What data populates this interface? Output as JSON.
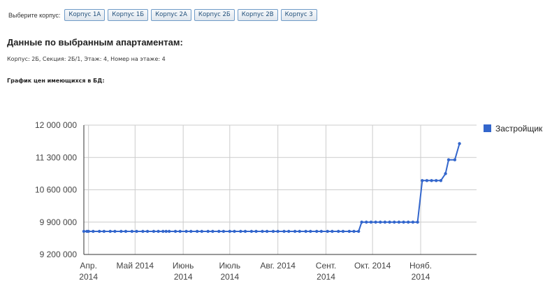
{
  "selector": {
    "prompt": "Выберите корпус:",
    "buttons": [
      "Корпус 1А",
      "Корпус 1Б",
      "Корпус 2А",
      "Корпус 2Б",
      "Корпус 2В",
      "Корпус 3"
    ]
  },
  "heading": "Данные по выбранным апартаментам:",
  "info": "Корпус: 2Б, Секция: 2Б/1, Этаж: 4, Номер на этаже: 4",
  "chart_caption": "График цен имеющихся в БД:",
  "colors": {
    "series": "#3366cc",
    "gridline": "#cccccc",
    "axis": "#333333"
  },
  "chart_data": {
    "type": "line",
    "title": "",
    "xlabel": "",
    "ylabel": "",
    "x_range": [
      "2014-03-29",
      "2014-12-07"
    ],
    "ylim": [
      9200000,
      12000000
    ],
    "y_ticks": [
      9200000,
      9900000,
      10600000,
      11300000,
      12000000
    ],
    "y_tick_labels": [
      "9 200 000",
      "9 900 000",
      "10 600 000",
      "11 300 000",
      "12 000 000"
    ],
    "x_ticks": [
      {
        "date": "2014-04-01",
        "line1": "Апр.",
        "line2": "2014"
      },
      {
        "date": "2014-05-01",
        "line1": "Май 2014",
        "line2": ""
      },
      {
        "date": "2014-06-01",
        "line1": "Июнь",
        "line2": "2014"
      },
      {
        "date": "2014-07-01",
        "line1": "Июль",
        "line2": "2014"
      },
      {
        "date": "2014-08-01",
        "line1": "Авг. 2014",
        "line2": ""
      },
      {
        "date": "2014-09-01",
        "line1": "Сент.",
        "line2": "2014"
      },
      {
        "date": "2014-10-01",
        "line1": "Окт. 2014",
        "line2": ""
      },
      {
        "date": "2014-11-01",
        "line1": "Нояб.",
        "line2": "2014"
      }
    ],
    "grid": true,
    "legend_position": "right",
    "series": [
      {
        "name": "Застройщик",
        "points": [
          [
            "2014-03-29",
            9700000
          ],
          [
            "2014-03-31",
            9700000
          ],
          [
            "2014-04-01",
            9700000
          ],
          [
            "2014-04-04",
            9700000
          ],
          [
            "2014-04-08",
            9700000
          ],
          [
            "2014-04-11",
            9700000
          ],
          [
            "2014-04-15",
            9700000
          ],
          [
            "2014-04-18",
            9700000
          ],
          [
            "2014-04-22",
            9700000
          ],
          [
            "2014-04-25",
            9700000
          ],
          [
            "2014-04-29",
            9700000
          ],
          [
            "2014-05-02",
            9700000
          ],
          [
            "2014-05-06",
            9700000
          ],
          [
            "2014-05-09",
            9700000
          ],
          [
            "2014-05-13",
            9700000
          ],
          [
            "2014-05-16",
            9700000
          ],
          [
            "2014-05-19",
            9700000
          ],
          [
            "2014-05-21",
            9700000
          ],
          [
            "2014-05-23",
            9700000
          ],
          [
            "2014-05-27",
            9700000
          ],
          [
            "2014-05-30",
            9700000
          ],
          [
            "2014-06-03",
            9700000
          ],
          [
            "2014-06-06",
            9700000
          ],
          [
            "2014-06-10",
            9700000
          ],
          [
            "2014-06-13",
            9700000
          ],
          [
            "2014-06-17",
            9700000
          ],
          [
            "2014-06-20",
            9700000
          ],
          [
            "2014-06-24",
            9700000
          ],
          [
            "2014-06-27",
            9700000
          ],
          [
            "2014-07-01",
            9700000
          ],
          [
            "2014-07-04",
            9700000
          ],
          [
            "2014-07-08",
            9700000
          ],
          [
            "2014-07-11",
            9700000
          ],
          [
            "2014-07-15",
            9700000
          ],
          [
            "2014-07-18",
            9700000
          ],
          [
            "2014-07-22",
            9700000
          ],
          [
            "2014-07-25",
            9700000
          ],
          [
            "2014-07-29",
            9700000
          ],
          [
            "2014-08-01",
            9700000
          ],
          [
            "2014-08-05",
            9700000
          ],
          [
            "2014-08-08",
            9700000
          ],
          [
            "2014-08-12",
            9700000
          ],
          [
            "2014-08-15",
            9700000
          ],
          [
            "2014-08-19",
            9700000
          ],
          [
            "2014-08-22",
            9700000
          ],
          [
            "2014-08-26",
            9700000
          ],
          [
            "2014-08-29",
            9700000
          ],
          [
            "2014-09-02",
            9700000
          ],
          [
            "2014-09-05",
            9700000
          ],
          [
            "2014-09-09",
            9700000
          ],
          [
            "2014-09-12",
            9700000
          ],
          [
            "2014-09-16",
            9700000
          ],
          [
            "2014-09-19",
            9700000
          ],
          [
            "2014-09-22",
            9700000
          ],
          [
            "2014-09-24",
            9900000
          ],
          [
            "2014-09-27",
            9900000
          ],
          [
            "2014-09-30",
            9900000
          ],
          [
            "2014-10-03",
            9900000
          ],
          [
            "2014-10-06",
            9900000
          ],
          [
            "2014-10-09",
            9900000
          ],
          [
            "2014-10-12",
            9900000
          ],
          [
            "2014-10-15",
            9900000
          ],
          [
            "2014-10-18",
            9900000
          ],
          [
            "2014-10-21",
            9900000
          ],
          [
            "2014-10-24",
            9900000
          ],
          [
            "2014-10-27",
            9900000
          ],
          [
            "2014-10-30",
            9900000
          ],
          [
            "2014-11-02",
            10800000
          ],
          [
            "2014-11-05",
            10800000
          ],
          [
            "2014-11-08",
            10800000
          ],
          [
            "2014-11-11",
            10800000
          ],
          [
            "2014-11-14",
            10800000
          ],
          [
            "2014-11-17",
            10950000
          ],
          [
            "2014-11-19",
            11250000
          ],
          [
            "2014-11-23",
            11250000
          ],
          [
            "2014-11-26",
            11600000
          ]
        ]
      }
    ]
  }
}
